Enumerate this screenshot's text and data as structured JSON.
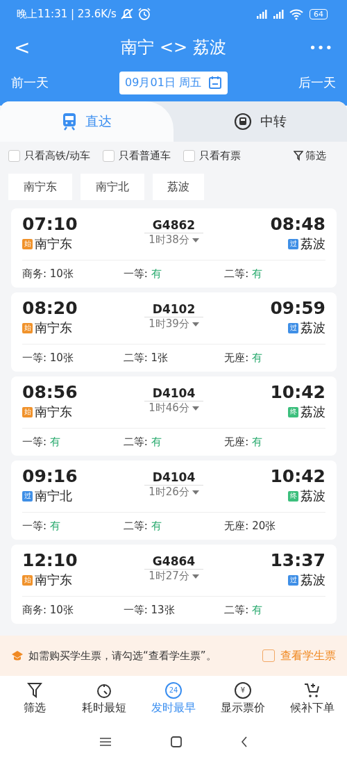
{
  "status_bar": {
    "time": "晚上11:31 | 23.6K/s",
    "battery": "64"
  },
  "header": {
    "title": "南宁 <> 荔波",
    "back": "<",
    "more": "•••"
  },
  "date_bar": {
    "prev": "前一天",
    "date": "09月01日 周五",
    "next": "后一天"
  },
  "tabs": [
    {
      "label": "直达",
      "selected": true,
      "kind": "direct"
    },
    {
      "label": "中转",
      "selected": false,
      "kind": "transfer"
    }
  ],
  "filters": [
    {
      "label": "只看高铁/动车",
      "checked": false
    },
    {
      "label": "只看普通车",
      "checked": false
    },
    {
      "label": "只看有票",
      "checked": false
    }
  ],
  "filter_button": "筛选",
  "stations": [
    "南宁东",
    "南宁北",
    "荔波"
  ],
  "trains": [
    {
      "depart": "07:10",
      "from": {
        "kind": "start",
        "badge": "始",
        "name": "南宁东"
      },
      "number": "G4862",
      "duration": "1时38分",
      "arrive": "08:48",
      "to": {
        "kind": "pass",
        "badge": "过",
        "name": "荔波"
      },
      "seats": [
        {
          "label": "商务:",
          "value": "10张",
          "available": false
        },
        {
          "label": "一等:",
          "value": "有",
          "available": true
        },
        {
          "label": "二等:",
          "value": "有",
          "available": true
        }
      ]
    },
    {
      "depart": "08:20",
      "from": {
        "kind": "start",
        "badge": "始",
        "name": "南宁东"
      },
      "number": "D4102",
      "duration": "1时39分",
      "arrive": "09:59",
      "to": {
        "kind": "pass",
        "badge": "过",
        "name": "荔波"
      },
      "seats": [
        {
          "label": "一等:",
          "value": "10张",
          "available": false
        },
        {
          "label": "二等:",
          "value": "1张",
          "available": false
        },
        {
          "label": "无座:",
          "value": "有",
          "available": true
        }
      ]
    },
    {
      "depart": "08:56",
      "from": {
        "kind": "start",
        "badge": "始",
        "name": "南宁东"
      },
      "number": "D4104",
      "duration": "1时46分",
      "arrive": "10:42",
      "to": {
        "kind": "end",
        "badge": "终",
        "name": "荔波"
      },
      "seats": [
        {
          "label": "一等:",
          "value": "有",
          "available": true
        },
        {
          "label": "二等:",
          "value": "有",
          "available": true
        },
        {
          "label": "无座:",
          "value": "有",
          "available": true
        }
      ]
    },
    {
      "depart": "09:16",
      "from": {
        "kind": "pass",
        "badge": "过",
        "name": "南宁北"
      },
      "number": "D4104",
      "duration": "1时26分",
      "arrive": "10:42",
      "to": {
        "kind": "end",
        "badge": "终",
        "name": "荔波"
      },
      "seats": [
        {
          "label": "一等:",
          "value": "有",
          "available": true
        },
        {
          "label": "二等:",
          "value": "有",
          "available": true
        },
        {
          "label": "无座:",
          "value": "20张",
          "available": false
        }
      ]
    },
    {
      "depart": "12:10",
      "from": {
        "kind": "start",
        "badge": "始",
        "name": "南宁东"
      },
      "number": "G4864",
      "duration": "1时27分",
      "arrive": "13:37",
      "to": {
        "kind": "pass",
        "badge": "过",
        "name": "荔波"
      },
      "seats": [
        {
          "label": "商务:",
          "value": "10张",
          "available": false
        },
        {
          "label": "一等:",
          "value": "13张",
          "available": false
        },
        {
          "label": "二等:",
          "value": "有",
          "available": true
        }
      ]
    }
  ],
  "student_banner": {
    "text": "如需购买学生票，请勾选“查看学生票”。",
    "option": "查看学生票",
    "checked": false
  },
  "bottom_nav": [
    {
      "label": "筛选",
      "kind": "filter",
      "selected": false
    },
    {
      "label": "耗时最短",
      "kind": "clock",
      "selected": false
    },
    {
      "label": "发时最早",
      "kind": "early",
      "icon_text": "24",
      "selected": true
    },
    {
      "label": "显示票价",
      "kind": "price",
      "icon_text": "¥",
      "selected": false
    },
    {
      "label": "候补下单",
      "kind": "cart",
      "selected": false
    }
  ]
}
